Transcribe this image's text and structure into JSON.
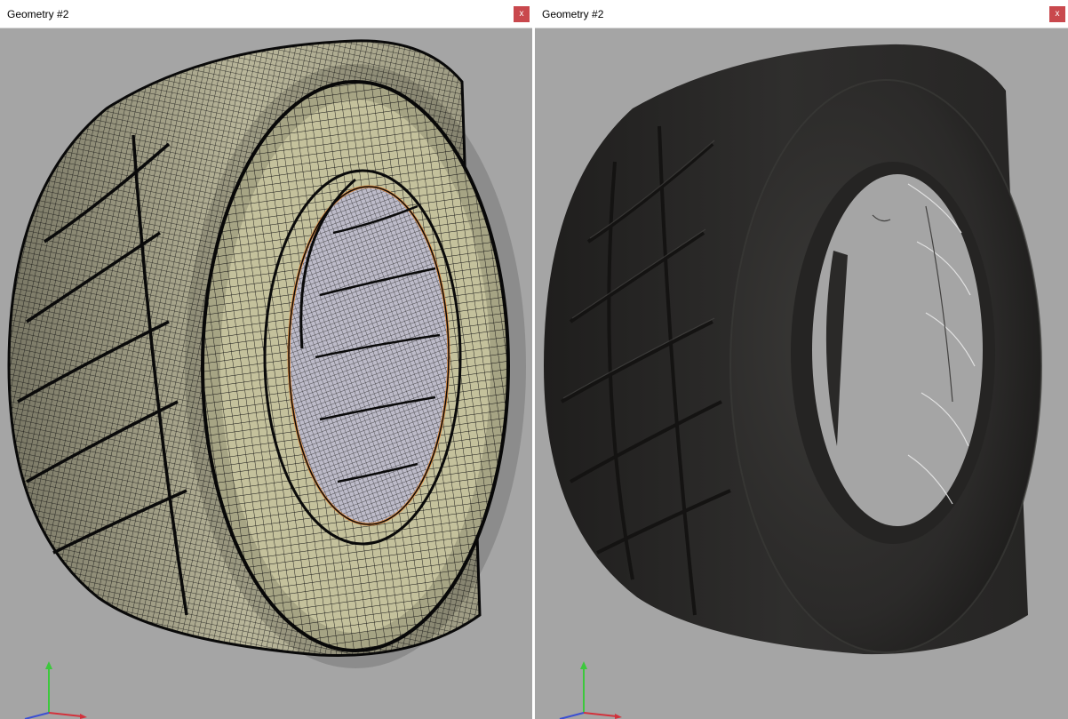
{
  "panes": [
    {
      "title": "Geometry #2",
      "close_label": "x",
      "render_mode": "wireframe-shaded"
    },
    {
      "title": "Geometry #2",
      "close_label": "x",
      "render_mode": "shaded"
    }
  ],
  "colors": {
    "viewport_background": "#a5a5a5",
    "close_button": "#c9484d",
    "mesh_surface": "#c4c19c",
    "mesh_wire": "#141414",
    "inner_liner": "#bdbbc9",
    "bead_edge": "#e0883a",
    "rubber": "#2d2c2b",
    "axis_x": "#d2323c",
    "axis_y": "#3cc83c",
    "axis_z": "#3c50d2"
  },
  "axis_gizmo_icon": "xyz-axes-icon"
}
